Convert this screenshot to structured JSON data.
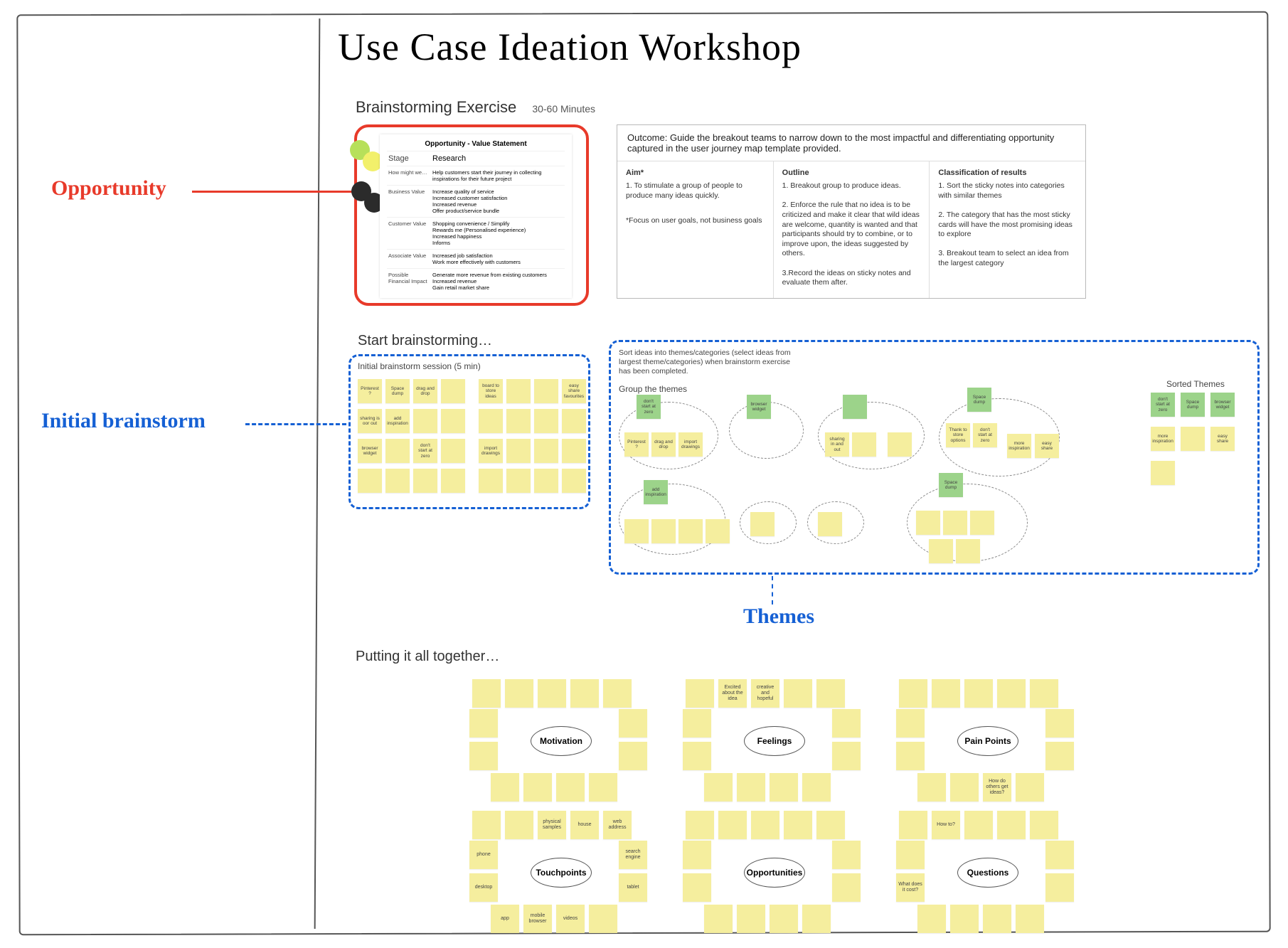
{
  "title": "Use Case Ideation Workshop",
  "labels": {
    "opportunity": "Opportunity",
    "initial": "Initial brainstorm",
    "themes": "Themes"
  },
  "brainstorm": {
    "heading": "Brainstorming Exercise",
    "duration": "30-60 Minutes",
    "start": "Start brainstorming…",
    "initial_caption": "Initial brainstorm session (5 min)",
    "putting": "Putting it all together…"
  },
  "opportunity": {
    "card_title": "Opportunity - Value Statement",
    "rows": [
      {
        "k": "Stage",
        "v": "Research"
      },
      {
        "k": "How might we…",
        "v": "Help customers start their journey in collecting inspirations for their future project"
      },
      {
        "k": "Business Value",
        "v": "Increase quality of service\nIncreased customer satisfaction\nIncreased revenue\nOffer product/service bundle"
      },
      {
        "k": "Customer Value",
        "v": "Shopping convenience / Simplify\nRewards me (Personalised experience)\nIncreased happiness\nInforms"
      },
      {
        "k": "Associate Value",
        "v": "Increased job satisfaction\nWork more effectively with customers"
      },
      {
        "k": "Possible Financial Impact",
        "v": "Generate more revenue from existing customers\nIncreased revenue\nGain retail market share"
      }
    ]
  },
  "outcome": {
    "head": "Outcome: Guide the breakout teams to narrow down to the most impactful and differentiating opportunity captured in the user journey map template provided.",
    "cols": [
      {
        "title": "Aim*",
        "body": "1. To stimulate a group of people to produce many ideas quickly.",
        "foot": "*Focus on user goals, not business goals"
      },
      {
        "title": "Outline",
        "body": "1. Breakout group to produce ideas.\n\n2. Enforce the rule that no idea is to be criticized and make it clear that wild ideas are welcome, quantity is wanted and that participants should try to combine, or to improve upon, the ideas suggested by others.\n\n3.Record the ideas on sticky notes and evaluate them after."
      },
      {
        "title": "Classification of results",
        "body": "1. Sort the sticky notes into categories with similar themes\n\n2. The category that has the most sticky cards will have the most promising ideas to explore\n\n3. Breakout team to select an idea from the largest category"
      }
    ]
  },
  "themes": {
    "instruction": "Sort ideas into themes/categories (select ideas from largest theme/categories) when brainstorm exercise has been completed.",
    "group_label": "Group the themes",
    "sorted_label": "Sorted Themes"
  },
  "initial_notes_row1": [
    "Pinterest ?",
    "Space dump",
    "drag and drop",
    "",
    "board to store ideas",
    "",
    "",
    "easy share favourites"
  ],
  "initial_notes_row2": [
    "sharing is oor out",
    "add inspiration",
    "",
    "",
    "",
    "",
    "",
    ""
  ],
  "initial_notes_row3": [
    "browser widget",
    "",
    "don't start at zero",
    "",
    "import drawings",
    "",
    "",
    ""
  ],
  "initial_notes_row4": [
    "",
    "",
    "",
    "",
    "",
    "",
    "",
    ""
  ],
  "theme_headers": [
    "don't start at zero",
    "browser widget",
    "",
    "",
    "Space dump",
    "add inspiration",
    "Space dump"
  ],
  "theme_notes": [
    "Pinterest ?",
    "drag and drop",
    "import drawings",
    "sharing in and out",
    "",
    "",
    "Thank to store options",
    "don't start at zero",
    "more inspiration",
    "easy share"
  ],
  "sorted_headers": [
    "don't start at zero",
    "Space dump",
    "browser widget"
  ],
  "sorted_notes": [
    "more inspiration",
    "",
    "easy share"
  ],
  "empathy": {
    "motivation": {
      "label": "Motivation",
      "notes": [
        "",
        "",
        "",
        "",
        "",
        "",
        "",
        "",
        "",
        "",
        "",
        "",
        ""
      ]
    },
    "feelings": {
      "label": "Feelings",
      "notes": [
        "Excited about the idea",
        "creative and hopeful",
        "",
        "",
        "",
        "",
        "",
        "",
        "",
        "",
        "",
        "",
        ""
      ]
    },
    "pain": {
      "label": "Pain Points",
      "notes": [
        "",
        "",
        "",
        "",
        "",
        "",
        "",
        "",
        "",
        "How do others get ideas?",
        "",
        "",
        ""
      ]
    },
    "touchpoints": {
      "label": "Touchpoints",
      "notes": [
        "",
        "physical samples",
        "house",
        "phone",
        "desktop",
        "search engine",
        "tablet",
        "app",
        "mobile browser",
        "videos",
        "",
        "web address",
        ""
      ]
    },
    "opportunities": {
      "label": "Opportunities",
      "notes": [
        "",
        "",
        "",
        "",
        "",
        "",
        "",
        "",
        "",
        "",
        "",
        "",
        ""
      ]
    },
    "questions": {
      "label": "Questions",
      "notes": [
        "How to?",
        "",
        "",
        "",
        "What does it cost?",
        "",
        "",
        "",
        "",
        "",
        "",
        "",
        ""
      ]
    }
  }
}
